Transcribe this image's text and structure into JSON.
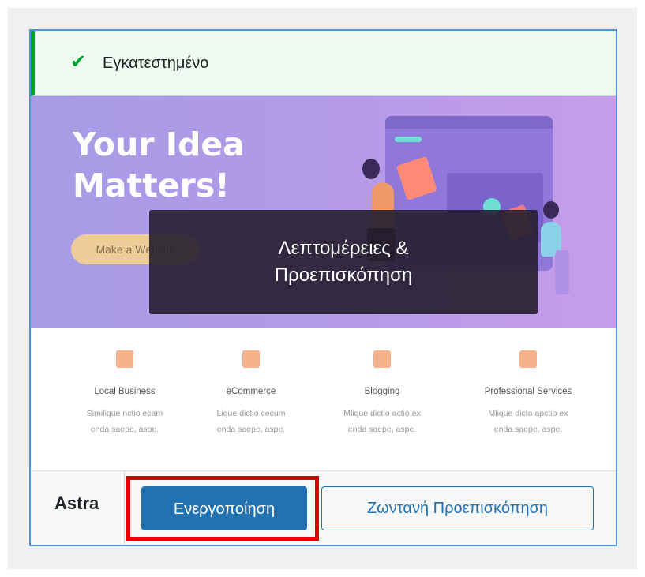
{
  "notice": {
    "icon": "checkmark-icon",
    "text": "Εγκατεστημένο",
    "color": "#00a32a"
  },
  "hero": {
    "headline": "Your Idea Matters!",
    "cta_label": "Make a Website",
    "overlay_label_line1": "Λεπτομέρειες &",
    "overlay_label_line2": "Προεπισκόπηση"
  },
  "features": [
    {
      "icon": "store-icon",
      "title": "Local Business",
      "desc_line1": "Similique nctio ecam",
      "desc_line2": "enda saepe, aspe."
    },
    {
      "icon": "cart-icon",
      "title": "eCommerce",
      "desc_line1": "Lique dictio cecum",
      "desc_line2": "enda saepe, aspe."
    },
    {
      "icon": "pencil-icon",
      "title": "Blogging",
      "desc_line1": "Mlique dictio actio ex",
      "desc_line2": "enda saepe, aspe."
    },
    {
      "icon": "person-icon",
      "title": "Professional Services",
      "desc_line1": "Mlique dicto apctio ex",
      "desc_line2": "enda saepe, aspe."
    }
  ],
  "footer": {
    "theme_name": "Astra",
    "activate_label": "Ενεργοποίηση",
    "live_preview_label": "Ζωντανή Προεπισκόπηση"
  },
  "colors": {
    "primary": "#2271b1",
    "highlight": "#e00000",
    "accent_icon": "#f6b28a"
  }
}
